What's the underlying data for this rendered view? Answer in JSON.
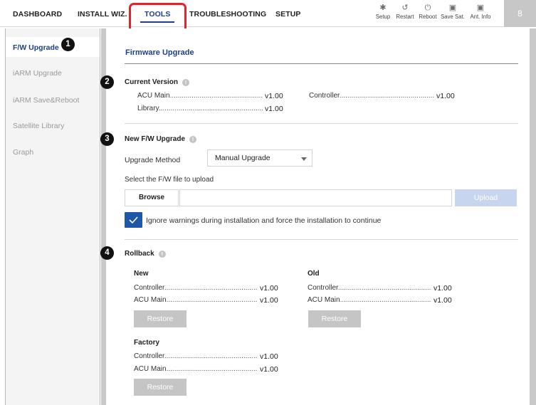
{
  "nav": {
    "tabs": [
      {
        "label": "DASHBOARD"
      },
      {
        "label": "INSTALL WIZ."
      },
      {
        "label": "TOOLS"
      },
      {
        "label": "TROUBLESHOOTING"
      },
      {
        "label": "SETUP"
      }
    ],
    "active_tab": "TOOLS",
    "tools": [
      {
        "label": "Setup",
        "icon": "gear-icon",
        "glyph": "✱"
      },
      {
        "label": "Restart",
        "icon": "restart-icon",
        "glyph": "↺"
      },
      {
        "label": "Reboot",
        "icon": "power-icon",
        "glyph": "⏻"
      },
      {
        "label": "Save Sat.",
        "icon": "save-icon",
        "glyph": "▣"
      },
      {
        "label": "Ant. Info",
        "icon": "antenna-info-icon",
        "glyph": "▣"
      }
    ],
    "user_glyph": "8"
  },
  "sidebar": {
    "items": [
      {
        "label": "F/W Upgrade"
      },
      {
        "label": "iARM Upgrade"
      },
      {
        "label": "iARM Save&Reboot"
      },
      {
        "label": "Satellite Library"
      },
      {
        "label": "Graph"
      }
    ],
    "active_index": 0
  },
  "markers": [
    "1",
    "2",
    "3",
    "4"
  ],
  "main": {
    "title": "Firmware Upgrade",
    "current_version": {
      "heading": "Current Version",
      "info_glyph": "!",
      "acu_main_label": "ACU Main",
      "acu_main_value": "v1.00",
      "library_label": "Library",
      "library_value": "v1.00",
      "controller_label": "Controller",
      "controller_value": "v1.00"
    },
    "new_upgrade": {
      "heading": "New F/W Upgrade",
      "method_label": "Upgrade Method",
      "method_value": "Manual Upgrade",
      "file_label": "Select the F/W file to upload",
      "browse_label": "Browse",
      "file_value": "",
      "upload_label": "Upload",
      "force_checked": true,
      "force_label": "Ignore warnings during installation and force the installation to continue"
    },
    "rollback": {
      "heading": "Rollback",
      "new": {
        "heading": "New",
        "controller_label": "Controller",
        "controller_value": "v1.00",
        "acu_main_label": "ACU Main",
        "acu_main_value": "v1.00",
        "restore_label": "Restore"
      },
      "old": {
        "heading": "Old",
        "controller_label": "Controller",
        "controller_value": "v1.00",
        "acu_main_label": "ACU Main",
        "acu_main_value": "v1.00",
        "restore_label": "Restore"
      },
      "factory": {
        "heading": "Factory",
        "controller_label": "Controller",
        "controller_value": "v1.00",
        "acu_main_label": "ACU Main",
        "acu_main_value": "v1.00",
        "restore_label": "Restore"
      }
    }
  },
  "colors": {
    "accent": "#1e3f8a",
    "highlight": "#e8202a",
    "checkbox": "#1f57a8",
    "upload_disabled": "#c7d5ef",
    "restore_disabled": "#c5c5c5"
  }
}
